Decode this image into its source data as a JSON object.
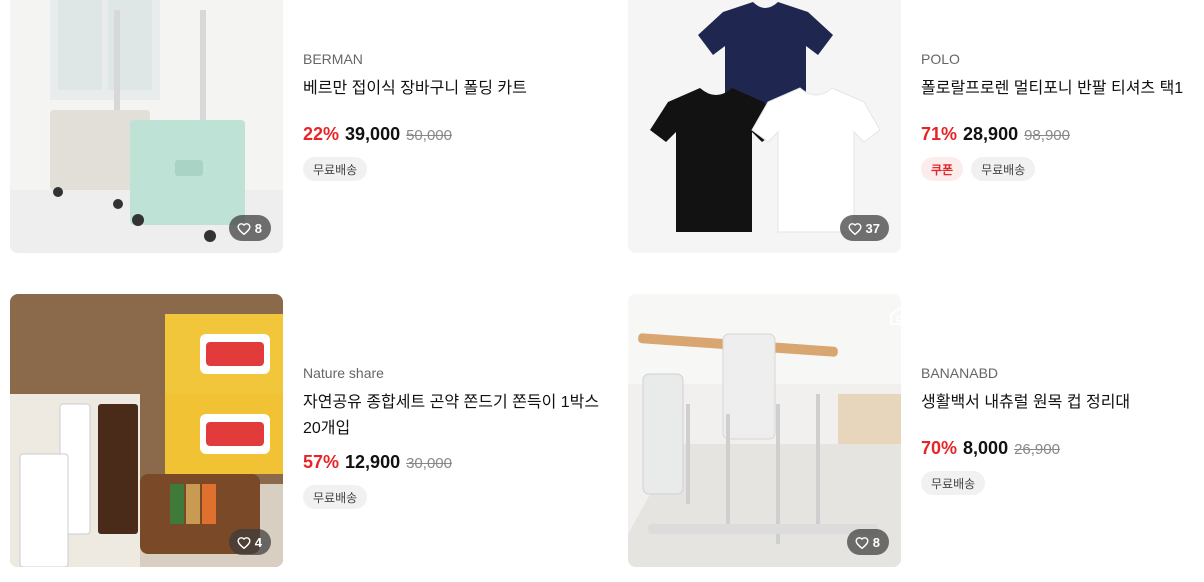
{
  "products": [
    {
      "brand": "BERMAN",
      "name": "베르만 접이식 장바구니 폴딩 카트",
      "discount": "22%",
      "price": "39,000",
      "original_price": "50,000",
      "likes": "8",
      "badges": {
        "coupon": "",
        "free_shipping": "무료배송"
      },
      "image_icon": "folding-cart-image"
    },
    {
      "brand": "POLO",
      "name": "폴로랄프로렌 멀티포니 반팔 티셔츠 택1",
      "discount": "71%",
      "price": "28,900",
      "original_price": "98,900",
      "likes": "37",
      "badges": {
        "coupon": "쿠폰",
        "free_shipping": "무료배송"
      },
      "image_icon": "tshirts-image"
    },
    {
      "brand": "Nature share",
      "name": "자연공유 종합세트 곤약 쫀드기 쫀득이 1박스 20개입",
      "discount": "57%",
      "price": "12,900",
      "original_price": "30,000",
      "likes": "4",
      "badges": {
        "coupon": "",
        "free_shipping": "무료배송"
      },
      "image_icon": "snack-box-image"
    },
    {
      "brand": "BANANABD",
      "name": "생활백서 내츄럴 원목 컵 정리대",
      "discount": "70%",
      "price": "8,000",
      "original_price": "26,900",
      "likes": "8",
      "badges": {
        "coupon": "",
        "free_shipping": "무료배송"
      },
      "image_icon": "cup-rack-image"
    }
  ],
  "colors": {
    "discount": "#e52528",
    "coupon_bg": "#fdecec",
    "badge_bg": "#f1f1f1"
  }
}
